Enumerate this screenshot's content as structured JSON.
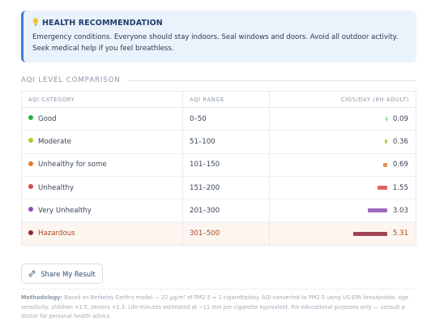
{
  "recommendation": {
    "title": "HEALTH RECOMMENDATION",
    "text": "Emergency conditions. Everyone should stay indoors. Seal windows and doors. Avoid all outdoor activity. Seek medical help if you feel breathless."
  },
  "comparison": {
    "heading": "AQI LEVEL COMPARISON",
    "columns": [
      "AQI CATEGORY",
      "AQI RANGE",
      "CIGS/DAY (8H ADULT)"
    ],
    "rows": [
      {
        "category": "Good",
        "range": "0–50",
        "cigs": "0.09",
        "color": "#22b33a",
        "highlight": false
      },
      {
        "category": "Moderate",
        "range": "51–100",
        "cigs": "0.36",
        "color": "#b8c42a",
        "highlight": false
      },
      {
        "category": "Unhealthy for some",
        "range": "101–150",
        "cigs": "0.69",
        "color": "#e57a2c",
        "highlight": false
      },
      {
        "category": "Unhealthy",
        "range": "151–200",
        "cigs": "1.55",
        "color": "#d24a4a",
        "highlight": false
      },
      {
        "category": "Very Unhealthy",
        "range": "201–300",
        "cigs": "3.03",
        "color": "#8b4fb8",
        "highlight": false
      },
      {
        "category": "Hazardous",
        "range": "301–500",
        "cigs": "5.31",
        "color": "#8e2438",
        "highlight": true
      }
    ]
  },
  "share": {
    "label": "Share My Result",
    "icon": "link-icon"
  },
  "methodology": {
    "label": "Methodology:",
    "text": " Based on Berkeley Earth's model — 22 µg/m³ of PM2.5 ≈ 1 cigarette/day. AQI converted to PM2.5 using US EPA breakpoints. Age sensitivity: children ×1.5, seniors ×1.3. Life-minutes estimated at ~11 min per cigarette equivalent. For educational purposes only — consult a doctor for personal health advice."
  }
}
